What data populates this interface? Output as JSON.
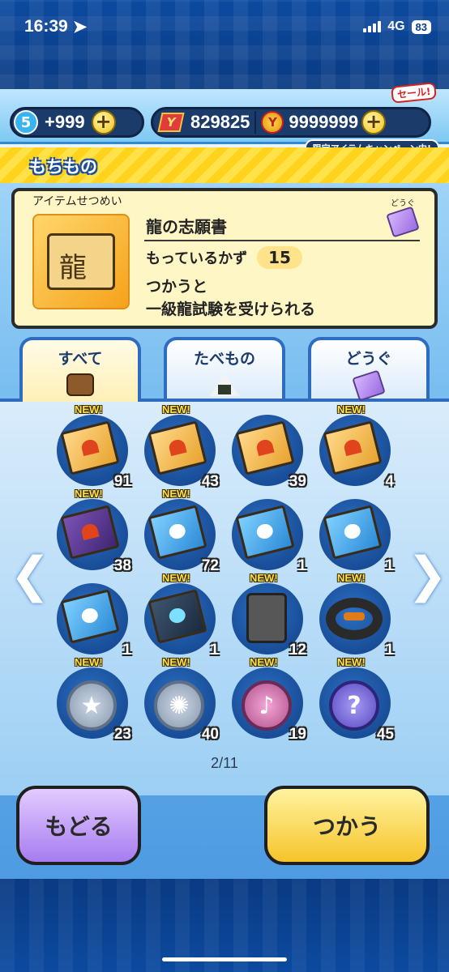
{
  "status": {
    "time": "16:39",
    "network": "4G",
    "battery": "83"
  },
  "header": {
    "stamina_level": "5",
    "stamina_value": "+999",
    "ycoins": "829825",
    "money": "9999999",
    "sale_label": "セール!",
    "campaign_label": "限定アイテムキャンペーン中!"
  },
  "page": {
    "title": "もちもの"
  },
  "description": {
    "section_label": "アイテムせつめい",
    "category": "どうぐ",
    "name": "龍の志願書",
    "count_label": "もっているかず",
    "count": "15",
    "text_line1": "つかうと",
    "text_line2": "一級龍試験を受けられる"
  },
  "tabs": [
    {
      "label": "すべて",
      "icon": "bag-icon"
    },
    {
      "label": "たべもの",
      "icon": "onigiri-icon"
    },
    {
      "label": "どうぐ",
      "icon": "ticket-icon"
    }
  ],
  "items": [
    {
      "new": "NEW!",
      "qty": "91",
      "icon": "gold-book-icon"
    },
    {
      "new": "NEW!",
      "qty": "43",
      "icon": "gold-book-icon"
    },
    {
      "new": "",
      "qty": "39",
      "icon": "gold-book-icon"
    },
    {
      "new": "NEW!",
      "qty": "4",
      "icon": "gold-book-icon"
    },
    {
      "new": "NEW!",
      "qty": "38",
      "icon": "purple-book-icon"
    },
    {
      "new": "NEW!",
      "qty": "72",
      "icon": "blue-book-icon"
    },
    {
      "new": "",
      "qty": "1",
      "icon": "blue-book-icon"
    },
    {
      "new": "",
      "qty": "1",
      "icon": "blue-book-icon"
    },
    {
      "new": "",
      "qty": "1",
      "icon": "blue-book-icon"
    },
    {
      "new": "NEW!",
      "qty": "1",
      "icon": "dark-book-icon"
    },
    {
      "new": "NEW!",
      "qty": "12",
      "icon": "plate-icon"
    },
    {
      "new": "NEW!",
      "qty": "1",
      "icon": "ring-icon"
    },
    {
      "new": "NEW!",
      "qty": "23",
      "icon": "star-medal-icon"
    },
    {
      "new": "NEW!",
      "qty": "40",
      "icon": "silver-medal-icon"
    },
    {
      "new": "NEW!",
      "qty": "19",
      "icon": "music-medal-icon"
    },
    {
      "new": "NEW!",
      "qty": "45",
      "icon": "question-medal-icon"
    }
  ],
  "pagination": "2/11",
  "buttons": {
    "back": "もどる",
    "use": "つかう"
  }
}
